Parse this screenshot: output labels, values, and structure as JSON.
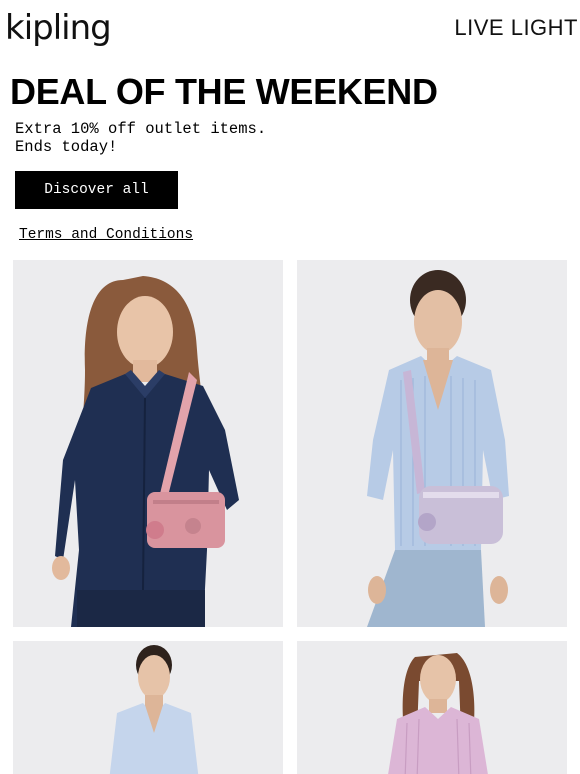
{
  "header": {
    "logo": "kipling",
    "tagline": "LIVE LIGHT"
  },
  "hero": {
    "headline": "DEAL OF THE WEEKEND",
    "subtext_line1": "Extra 10% off outlet items.",
    "subtext_line2": "Ends today!",
    "cta_label": "Discover all",
    "terms_label": "Terms and Conditions"
  },
  "products": [
    {
      "shirt": "denim",
      "bag_color": "#d9949e"
    },
    {
      "shirt": "light-blue-stripe",
      "bag_color": "#c9bfd8"
    },
    {
      "shirt": "light-blue",
      "bag_color": ""
    },
    {
      "shirt": "pink-stripe",
      "bag_color": ""
    }
  ],
  "colors": {
    "tile_background": "#ececee",
    "button_background": "#000000",
    "button_text": "#ffffff"
  }
}
